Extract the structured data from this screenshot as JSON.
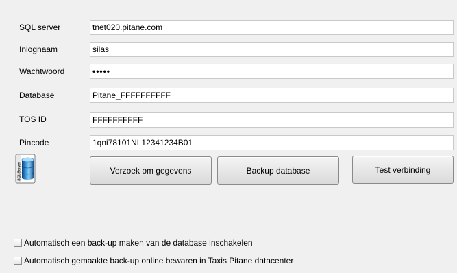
{
  "fields": [
    {
      "label": "SQL server",
      "value": "tnet020.pitane.com",
      "type": "text"
    },
    {
      "label": "Inlognaam",
      "value": "silas",
      "type": "text"
    },
    {
      "label": "Wachtwoord",
      "value": "•••••",
      "type": "password"
    },
    {
      "label": "Database",
      "value": "Pitane_FFFFFFFFFF",
      "type": "text"
    },
    {
      "label": "TOS ID",
      "value": "FFFFFFFFFF",
      "type": "text"
    },
    {
      "label": "Pincode",
      "value": "1qni78101NL12341234B01",
      "type": "text"
    }
  ],
  "icon": {
    "name": "sql-server-database-icon",
    "text": "SQLServer",
    "accent": "#1a6fb5"
  },
  "buttons": {
    "request": "Verzoek om gegevens",
    "backup": "Backup database",
    "test": "Test verbinding"
  },
  "checkboxes": [
    {
      "label": "Automatisch een back-up maken van de database inschakelen",
      "checked": false
    },
    {
      "label": "Automatisch gemaakte back-up online bewaren in Taxis Pitane datacenter",
      "checked": false
    }
  ]
}
